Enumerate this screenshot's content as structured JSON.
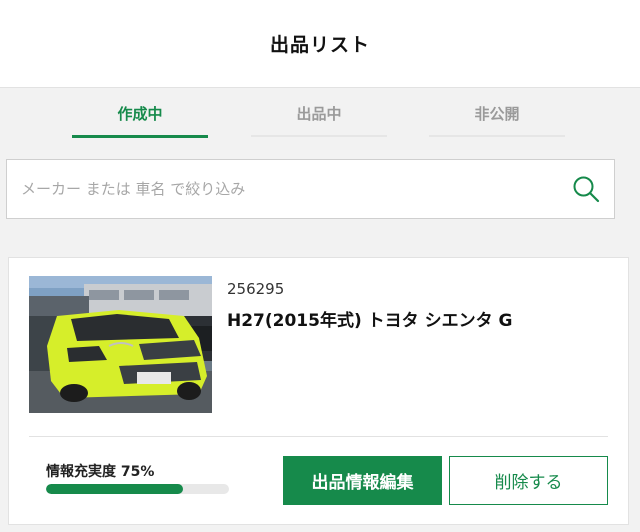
{
  "header": {
    "title": "出品リスト"
  },
  "tabs": [
    {
      "label": "作成中",
      "active": true
    },
    {
      "label": "出品中",
      "active": false
    },
    {
      "label": "非公開",
      "active": false
    }
  ],
  "search": {
    "placeholder": "メーカー または 車名 で絞り込み",
    "value": ""
  },
  "listing": {
    "id": "256295",
    "title": "H27(2015年式) トヨタ シエンタ G",
    "completion_label": "情報充実度 75%",
    "completion_percent": 75,
    "edit_label": "出品情報編集",
    "delete_label": "削除する"
  },
  "colors": {
    "accent": "#168a4b",
    "background": "#f2f2f2"
  },
  "icons": {
    "search": "search-icon"
  }
}
